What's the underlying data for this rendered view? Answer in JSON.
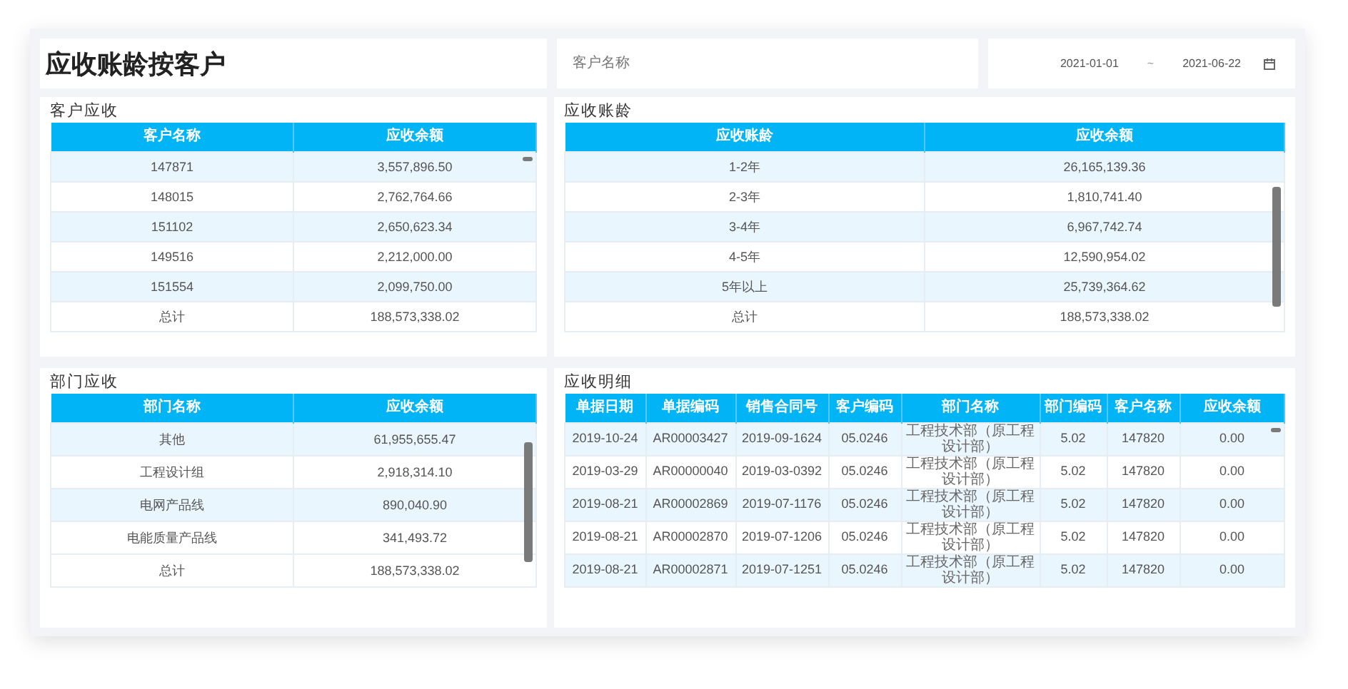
{
  "title": "应收账龄按客户",
  "customer_filter": {
    "placeholder": "客户名称"
  },
  "date_range": {
    "start": "2021-01-01",
    "separator": "~",
    "end": "2021-06-22"
  },
  "panels": [
    {
      "title": "客户应收",
      "kind": "summary",
      "columns": [
        "客户名称",
        "应收余额"
      ],
      "rows": [
        [
          "147871",
          "3,557,896.50"
        ],
        [
          "148015",
          "2,762,764.66"
        ],
        [
          "151102",
          "2,650,623.34"
        ],
        [
          "149516",
          "2,212,000.00"
        ],
        [
          "151554",
          "2,099,750.00"
        ]
      ],
      "total": [
        "总计",
        "188,573,338.02"
      ]
    },
    {
      "title": "应收账龄",
      "kind": "summary",
      "columns": [
        "应收账龄",
        "应收余额"
      ],
      "rows": [
        [
          "1-2年",
          "26,165,139.36"
        ],
        [
          "2-3年",
          "1,810,741.40"
        ],
        [
          "3-4年",
          "6,967,742.74"
        ],
        [
          "4-5年",
          "12,590,954.02"
        ],
        [
          "5年以上",
          "25,739,364.62"
        ]
      ],
      "total": [
        "总计",
        "188,573,338.02"
      ]
    },
    {
      "title": "部门应收",
      "kind": "summary",
      "columns": [
        "部门名称",
        "应收余额"
      ],
      "rows": [
        [
          "其他",
          "61,955,655.47"
        ],
        [
          "工程设计组",
          "2,918,314.10"
        ],
        [
          "电网产品线",
          "890,040.90"
        ],
        [
          "电能质量产品线",
          "341,493.72"
        ]
      ],
      "total": [
        "总计",
        "188,573,338.02"
      ]
    },
    {
      "title": "应收明细",
      "kind": "detail",
      "columns": [
        "单据日期",
        "单据编码",
        "销售合同号",
        "客户编码",
        "部门名称",
        "部门编码",
        "客户名称",
        "应收余额"
      ],
      "rows": [
        [
          "2019-10-24",
          "AR00003427",
          "2019-09-1624",
          "05.0246",
          "工程技术部（原工程设计部）",
          "5.02",
          "147820",
          "0.00"
        ],
        [
          "2019-03-29",
          "AR00000040",
          "2019-03-0392",
          "05.0246",
          "工程技术部（原工程设计部）",
          "5.02",
          "147820",
          "0.00"
        ],
        [
          "2019-08-21",
          "AR00002869",
          "2019-07-1176",
          "05.0246",
          "工程技术部（原工程设计部）",
          "5.02",
          "147820",
          "0.00"
        ],
        [
          "2019-08-21",
          "AR00002870",
          "2019-07-1206",
          "05.0246",
          "工程技术部（原工程设计部）",
          "5.02",
          "147820",
          "0.00"
        ],
        [
          "2019-08-21",
          "AR00002871",
          "2019-07-1251",
          "05.0246",
          "工程技术部（原工程设计部）",
          "5.02",
          "147820",
          "0.00"
        ]
      ]
    }
  ]
}
